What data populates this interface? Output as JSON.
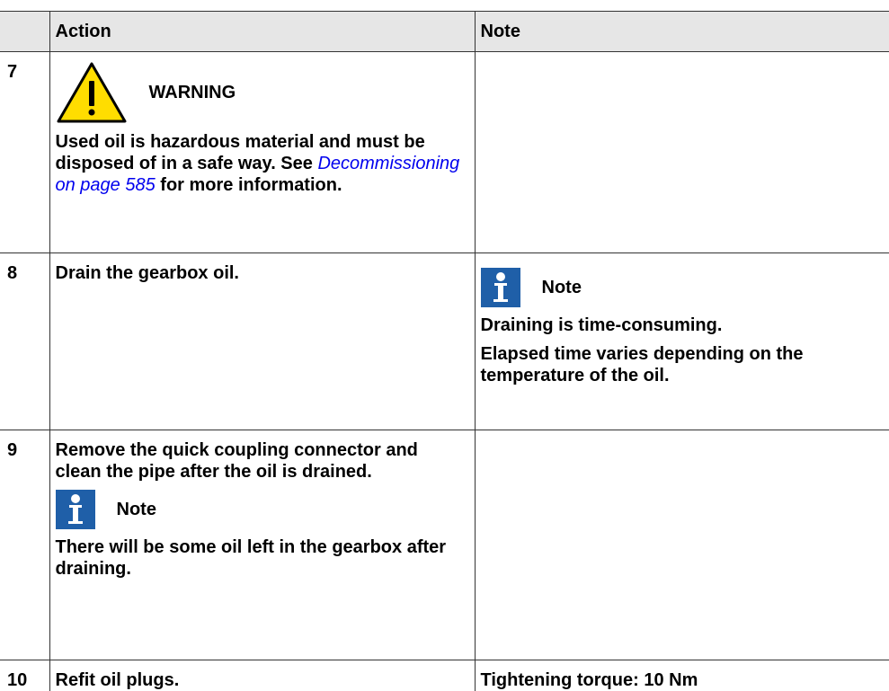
{
  "table": {
    "headers": {
      "number": "",
      "action": "Action",
      "note": "Note"
    },
    "rows": [
      {
        "step": "7",
        "warning": {
          "icon": "warning-triangle-icon",
          "title": "WARNING",
          "text_before": "Used oil is hazardous material and must be disposed of in a safe way. See ",
          "link": "Decommissioning on page 585",
          "text_after": " for more information."
        },
        "note": ""
      },
      {
        "step": "8",
        "action": "Drain the gearbox oil.",
        "note_callout": {
          "icon": "info-note-icon",
          "title": "Note",
          "lines": [
            "Draining is time-consuming.",
            "Elapsed time varies depending on the temperature of the oil."
          ]
        }
      },
      {
        "step": "9",
        "action": "Remove the quick coupling connector and clean the pipe after the oil is drained.",
        "action_callout": {
          "icon": "info-note-icon",
          "title": "Note",
          "text": "There will be some oil left in the gearbox after draining."
        },
        "note": ""
      },
      {
        "step": "10",
        "action": "Refit oil plugs.",
        "note": "Tightening torque: 10 Nm"
      }
    ]
  },
  "colors": {
    "header_bg": "#e6e6e6",
    "link": "#0000ee",
    "warning_yellow": "#ffdd00",
    "note_icon_blue": "#1f5fa8"
  }
}
